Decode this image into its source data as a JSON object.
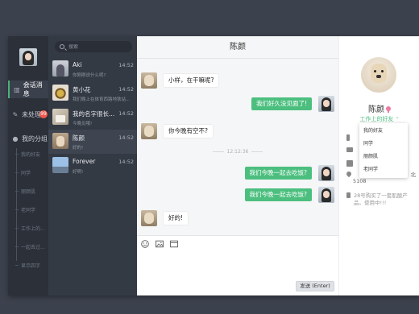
{
  "nav": {
    "items": [
      {
        "label": "会话消息",
        "icon": "message-icon",
        "active": true
      },
      {
        "label": "未处理",
        "icon": "chat-bubble-icon",
        "badge": "99"
      },
      {
        "label": "我的分组",
        "icon": "user-icon"
      }
    ],
    "groups": [
      "我的好友",
      "同学",
      "丽颜肌",
      "老同学",
      "工作上的...",
      "一起去过...",
      "显示四字"
    ]
  },
  "search": {
    "placeholder": "搜索"
  },
  "conversations": [
    {
      "name": "Aki",
      "time": "14:52",
      "preview": "你刚刚说什么呢?"
    },
    {
      "name": "黄小花",
      "time": "14:52",
      "preview": "我们晚上在体育西路地铁站..."
    },
    {
      "name": "我的名字很长...",
      "time": "14:52",
      "preview": "今晚见哦!"
    },
    {
      "name": "陈颜",
      "time": "14:52",
      "preview": "好的!"
    },
    {
      "name": "Forever",
      "time": "14:52",
      "preview": "好啊!"
    }
  ],
  "chat": {
    "title": "陈颜",
    "messages": [
      {
        "dir": "in",
        "text": "小样，在干嘛呢?"
      },
      {
        "dir": "out",
        "text": "我们好久没见面了!"
      },
      {
        "dir": "in",
        "text": "你今晚有空不?"
      },
      {
        "dir": "out",
        "text": "我们今晚一起去吃饭?"
      },
      {
        "dir": "out",
        "text": "我们今晚一起去吃饭?"
      },
      {
        "dir": "in",
        "text": "好的!"
      }
    ],
    "timestamp": "12:12:36",
    "send_label": "发送 (Enter)"
  },
  "profile": {
    "name": "陈颜",
    "group": "工作上的好友",
    "group_options": [
      "我的好友",
      "同学",
      "丽颜肌",
      "老同学"
    ],
    "info_tail": "北",
    "info_extra": "5",
    "info_tail2": "5108",
    "note": "28号购买了一套肌酸产品。使用中!!!"
  },
  "colors": {
    "accent": "#4cbf7f",
    "badge": "#f0584c"
  }
}
